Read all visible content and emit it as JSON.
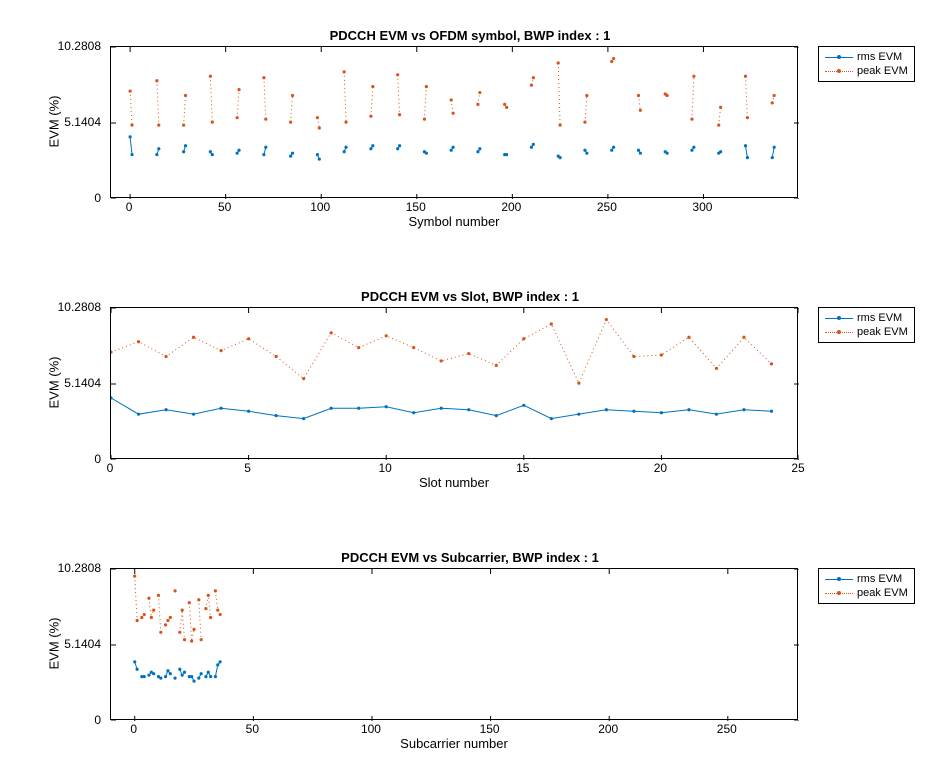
{
  "colors": {
    "rms": "#0072BD",
    "peak": "#D95319"
  },
  "legend": {
    "items": [
      "rms EVM",
      "peak EVM"
    ]
  },
  "chart_data": [
    {
      "type": "line",
      "title": "PDCCH EVM vs OFDM symbol, BWP index : 1",
      "xlabel": "Symbol number",
      "ylabel": "EVM (%)",
      "xlim": [
        -10,
        350
      ],
      "ylim": [
        0,
        10.2808
      ],
      "xticks": [
        0,
        50,
        100,
        150,
        200,
        250,
        300
      ],
      "yticks": [
        0,
        5.1404,
        10.2808
      ],
      "series": [
        {
          "name": "rms EVM",
          "style": "solid",
          "segments": [
            [
              [
                0,
                4.2
              ],
              [
                1,
                3.0
              ]
            ],
            [
              [
                14,
                3.0
              ],
              [
                15,
                3.4
              ]
            ],
            [
              [
                28,
                3.2
              ],
              [
                29,
                3.6
              ]
            ],
            [
              [
                42,
                3.2
              ],
              [
                43,
                3.0
              ]
            ],
            [
              [
                56,
                3.1
              ],
              [
                57,
                3.3
              ]
            ],
            [
              [
                70,
                3.0
              ],
              [
                71,
                3.5
              ]
            ],
            [
              [
                84,
                2.9
              ],
              [
                85,
                3.1
              ]
            ],
            [
              [
                98,
                3.0
              ],
              [
                99,
                2.7
              ]
            ],
            [
              [
                112,
                3.2
              ],
              [
                113,
                3.5
              ]
            ],
            [
              [
                126,
                3.4
              ],
              [
                127,
                3.6
              ]
            ],
            [
              [
                140,
                3.4
              ],
              [
                141,
                3.6
              ]
            ],
            [
              [
                154,
                3.2
              ],
              [
                155,
                3.1
              ]
            ],
            [
              [
                168,
                3.3
              ],
              [
                169,
                3.5
              ]
            ],
            [
              [
                182,
                3.2
              ],
              [
                183,
                3.4
              ]
            ],
            [
              [
                196,
                3.0
              ],
              [
                197,
                3.0
              ]
            ],
            [
              [
                210,
                3.5
              ],
              [
                211,
                3.7
              ]
            ],
            [
              [
                224,
                2.9
              ],
              [
                225,
                2.8
              ]
            ],
            [
              [
                238,
                3.3
              ],
              [
                239,
                3.1
              ]
            ],
            [
              [
                252,
                3.3
              ],
              [
                253,
                3.5
              ]
            ],
            [
              [
                266,
                3.3
              ],
              [
                267,
                3.1
              ]
            ],
            [
              [
                280,
                3.2
              ],
              [
                281,
                3.1
              ]
            ],
            [
              [
                294,
                3.3
              ],
              [
                295,
                3.5
              ]
            ],
            [
              [
                308,
                3.1
              ],
              [
                309,
                3.2
              ]
            ],
            [
              [
                322,
                3.6
              ],
              [
                323,
                2.8
              ]
            ],
            [
              [
                336,
                2.8
              ],
              [
                337,
                3.5
              ]
            ]
          ]
        },
        {
          "name": "peak EVM",
          "style": "dotted",
          "segments": [
            [
              [
                0,
                7.3
              ],
              [
                1,
                5.0
              ]
            ],
            [
              [
                14,
                8.0
              ],
              [
                15,
                5.0
              ]
            ],
            [
              [
                28,
                5.0
              ],
              [
                29,
                7.0
              ]
            ],
            [
              [
                42,
                8.3
              ],
              [
                43,
                5.2
              ]
            ],
            [
              [
                56,
                5.5
              ],
              [
                57,
                7.4
              ]
            ],
            [
              [
                70,
                8.2
              ],
              [
                71,
                5.4
              ]
            ],
            [
              [
                84,
                5.2
              ],
              [
                85,
                7.0
              ]
            ],
            [
              [
                98,
                5.5
              ],
              [
                99,
                4.8
              ]
            ],
            [
              [
                112,
                8.6
              ],
              [
                113,
                5.2
              ]
            ],
            [
              [
                126,
                5.6
              ],
              [
                127,
                7.6
              ]
            ],
            [
              [
                140,
                8.4
              ],
              [
                141,
                5.7
              ]
            ],
            [
              [
                154,
                5.4
              ],
              [
                155,
                7.6
              ]
            ],
            [
              [
                168,
                6.7
              ],
              [
                169,
                5.8
              ]
            ],
            [
              [
                182,
                6.4
              ],
              [
                183,
                7.2
              ]
            ],
            [
              [
                196,
                6.4
              ],
              [
                197,
                6.2
              ]
            ],
            [
              [
                210,
                7.7
              ],
              [
                211,
                8.2
              ]
            ],
            [
              [
                224,
                9.2
              ],
              [
                225,
                5.0
              ]
            ],
            [
              [
                238,
                5.2
              ],
              [
                239,
                7.0
              ]
            ],
            [
              [
                252,
                9.3
              ],
              [
                253,
                9.5
              ]
            ],
            [
              [
                266,
                7.0
              ],
              [
                267,
                6.0
              ]
            ],
            [
              [
                280,
                7.1
              ],
              [
                281,
                7.0
              ]
            ],
            [
              [
                294,
                5.4
              ],
              [
                295,
                8.3
              ]
            ],
            [
              [
                308,
                5.0
              ],
              [
                309,
                6.2
              ]
            ],
            [
              [
                322,
                8.3
              ],
              [
                323,
                5.5
              ]
            ],
            [
              [
                336,
                6.5
              ],
              [
                337,
                7.0
              ]
            ]
          ]
        }
      ]
    },
    {
      "type": "line",
      "title": "PDCCH EVM vs Slot, BWP index : 1",
      "xlabel": "Slot number",
      "ylabel": "EVM (%)",
      "xlim": [
        0,
        25
      ],
      "ylim": [
        0,
        10.2808
      ],
      "xticks": [
        0,
        5,
        10,
        15,
        20,
        25
      ],
      "yticks": [
        0,
        5.1404,
        10.2808
      ],
      "series": [
        {
          "name": "rms EVM",
          "style": "solid",
          "x": [
            0,
            1,
            2,
            3,
            4,
            5,
            6,
            7,
            8,
            9,
            10,
            11,
            12,
            13,
            14,
            15,
            16,
            17,
            18,
            19,
            20,
            21,
            22,
            23,
            24
          ],
          "y": [
            4.2,
            3.1,
            3.4,
            3.1,
            3.5,
            3.3,
            3.0,
            2.8,
            3.5,
            3.5,
            3.6,
            3.2,
            3.5,
            3.4,
            3.0,
            3.7,
            2.8,
            3.1,
            3.4,
            3.3,
            3.2,
            3.4,
            3.1,
            3.4,
            3.3
          ]
        },
        {
          "name": "peak EVM",
          "style": "dotted",
          "x": [
            0,
            1,
            2,
            3,
            4,
            5,
            6,
            7,
            8,
            9,
            10,
            11,
            12,
            13,
            14,
            15,
            16,
            17,
            18,
            19,
            20,
            21,
            22,
            23,
            24
          ],
          "y": [
            7.3,
            8.0,
            7.0,
            8.3,
            7.4,
            8.2,
            7.0,
            5.5,
            8.6,
            7.6,
            8.4,
            7.6,
            6.7,
            7.2,
            6.4,
            8.2,
            9.2,
            5.2,
            9.5,
            7.0,
            7.1,
            8.3,
            6.2,
            8.3,
            6.5
          ]
        }
      ]
    },
    {
      "type": "line",
      "title": "PDCCH EVM vs Subcarrier, BWP index : 1",
      "xlabel": "Subcarrier number",
      "ylabel": "EVM (%)",
      "xlim": [
        -10,
        280
      ],
      "ylim": [
        0,
        10.2808
      ],
      "xticks": [
        0,
        50,
        100,
        150,
        200,
        250
      ],
      "yticks": [
        0,
        5.1404,
        10.2808
      ],
      "series": [
        {
          "name": "rms EVM",
          "style": "solid",
          "segments": [
            [
              [
                0,
                4.0
              ],
              [
                1,
                3.5
              ]
            ],
            [
              [
                3,
                3.0
              ],
              [
                4,
                3.0
              ]
            ],
            [
              [
                6,
                3.1
              ],
              [
                7,
                3.3
              ],
              [
                8,
                3.2
              ]
            ],
            [
              [
                10,
                3.0
              ],
              [
                11,
                2.9
              ]
            ],
            [
              [
                13,
                3.0
              ],
              [
                14,
                3.4
              ],
              [
                15,
                3.2
              ]
            ],
            [
              [
                17,
                2.9
              ]
            ],
            [
              [
                19,
                3.5
              ],
              [
                20,
                3.1
              ],
              [
                21,
                3.3
              ]
            ],
            [
              [
                23,
                3.0
              ],
              [
                24,
                3.0
              ],
              [
                25,
                2.7
              ]
            ],
            [
              [
                27,
                2.9
              ],
              [
                28,
                3.2
              ]
            ],
            [
              [
                30,
                3.0
              ],
              [
                31,
                3.3
              ],
              [
                32,
                3.0
              ]
            ],
            [
              [
                34,
                3.0
              ],
              [
                35,
                3.8
              ],
              [
                36,
                4.0
              ]
            ]
          ]
        },
        {
          "name": "peak EVM",
          "style": "dotted",
          "segments": [
            [
              [
                0,
                9.8
              ],
              [
                1,
                6.8
              ]
            ],
            [
              [
                3,
                7.0
              ],
              [
                4,
                7.2
              ]
            ],
            [
              [
                6,
                8.3
              ],
              [
                7,
                7.0
              ],
              [
                8,
                7.5
              ]
            ],
            [
              [
                10,
                8.5
              ],
              [
                11,
                6.0
              ]
            ],
            [
              [
                13,
                6.5
              ],
              [
                14,
                6.8
              ],
              [
                15,
                7.0
              ]
            ],
            [
              [
                17,
                8.8
              ]
            ],
            [
              [
                19,
                6.0
              ],
              [
                20,
                7.5
              ],
              [
                21,
                5.5
              ]
            ],
            [
              [
                23,
                8.0
              ],
              [
                24,
                5.4
              ],
              [
                25,
                6.2
              ]
            ],
            [
              [
                27,
                8.2
              ],
              [
                28,
                5.5
              ]
            ],
            [
              [
                30,
                7.6
              ],
              [
                31,
                8.5
              ],
              [
                32,
                7.0
              ]
            ],
            [
              [
                34,
                8.8
              ],
              [
                35,
                7.5
              ],
              [
                36,
                7.2
              ]
            ]
          ]
        }
      ]
    }
  ]
}
